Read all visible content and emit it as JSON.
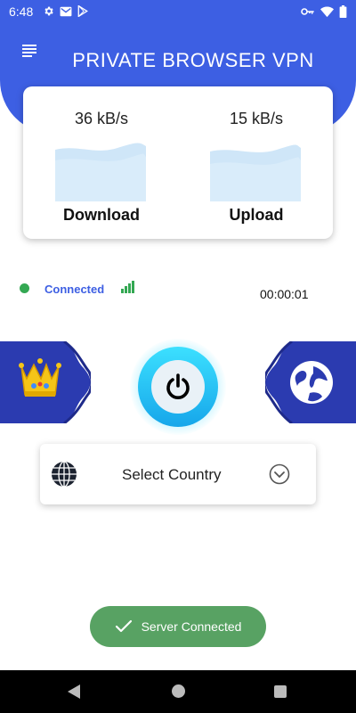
{
  "status_bar": {
    "time": "6:48",
    "left_icons": [
      "gear-icon",
      "gmail-icon",
      "play-store-icon"
    ],
    "right_icons": [
      "vpn-key-icon",
      "wifi-icon",
      "battery-icon"
    ]
  },
  "header": {
    "title": "PRIVATE BROWSER VPN",
    "menu_icon": "hamburger-menu-icon"
  },
  "speed": {
    "download": {
      "value": "36 kB/s",
      "label": "Download"
    },
    "upload": {
      "value": "15 kB/s",
      "label": "Upload"
    }
  },
  "connection": {
    "status": "Connected",
    "timer": "00:00:01",
    "status_color": "#34a853"
  },
  "side_buttons": {
    "left_icon": "crown-icon",
    "right_icon": "globe-icon"
  },
  "power": {
    "icon": "power-icon"
  },
  "country": {
    "label": "Select Country",
    "icon": "globe-icon",
    "chevron": "chevron-down-icon"
  },
  "toast": {
    "text": "Server Connected",
    "icon": "check-icon",
    "color": "#58a263"
  },
  "colors": {
    "primary": "#3d5fe3",
    "side_button": "#2b3bb0",
    "power_gradient_top": "#3ce0ff",
    "power_gradient_bottom": "#16a6ea"
  }
}
